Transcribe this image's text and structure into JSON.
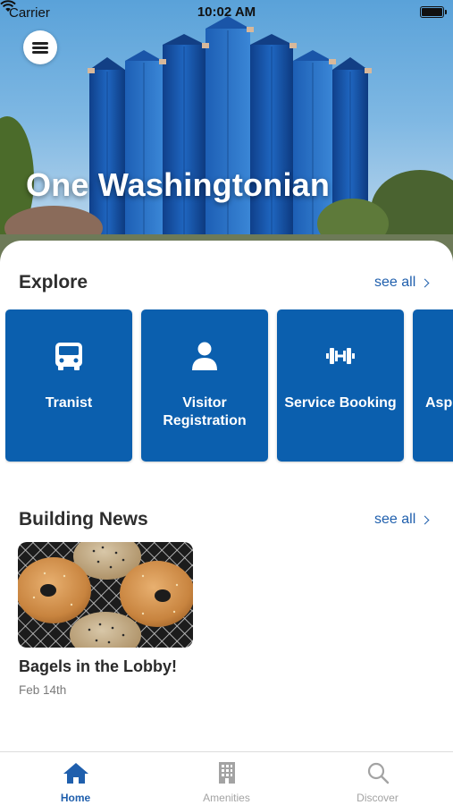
{
  "status_bar": {
    "carrier": "Carrier",
    "time": "10:02 AM"
  },
  "hero": {
    "title": "One Washingtonian",
    "menu_icon": "hamburger-menu-icon"
  },
  "explore": {
    "title": "Explore",
    "see_all": "see all",
    "tiles": [
      {
        "label": "Tranist",
        "icon": "bus-icon"
      },
      {
        "label": "Visitor Registration",
        "icon": "person-icon"
      },
      {
        "label": "Service Booking",
        "icon": "dumbbell-icon"
      },
      {
        "label": "Asp",
        "icon": "partial-tile"
      }
    ]
  },
  "news": {
    "title": "Building News",
    "see_all": "see all",
    "items": [
      {
        "title": "Bagels in the Lobby!",
        "date": "Feb 14th",
        "image": "bagels-photo"
      }
    ]
  },
  "tabbar": {
    "tabs": [
      {
        "label": "Home",
        "icon": "home-icon",
        "active": true
      },
      {
        "label": "Amenities",
        "icon": "building-icon",
        "active": false
      },
      {
        "label": "Discover",
        "icon": "search-icon",
        "active": false
      }
    ]
  },
  "colors": {
    "accent": "#1f5fad",
    "tile": "#0b5fae",
    "inactive": "#a3a3a3"
  }
}
